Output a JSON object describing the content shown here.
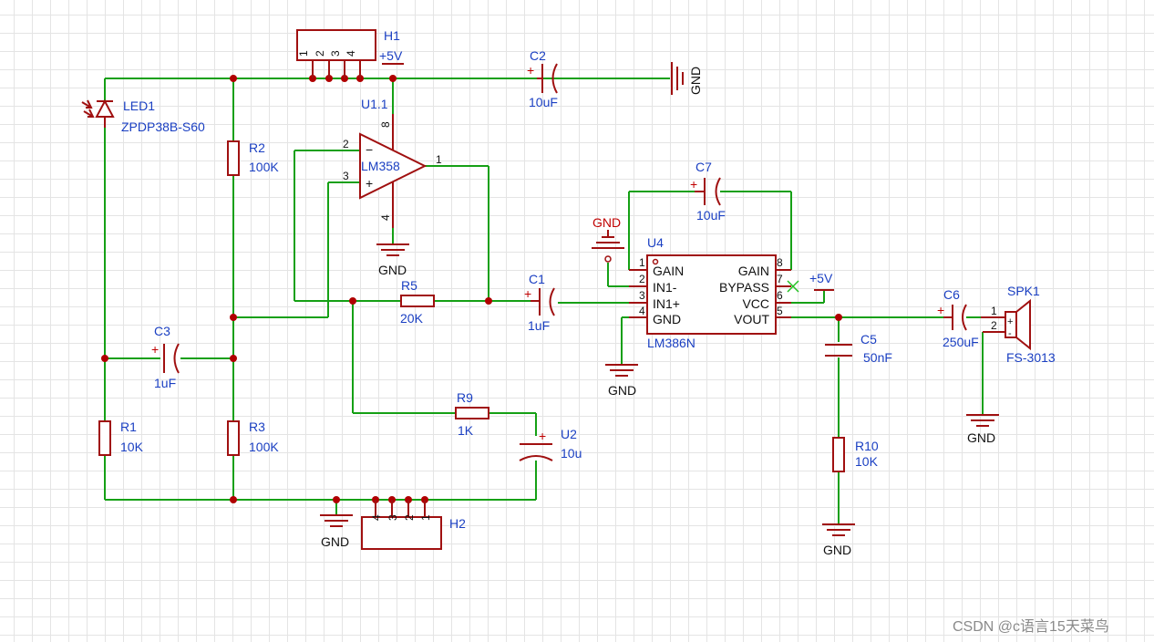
{
  "components": {
    "h1": {
      "ref": "H1",
      "pins": [
        "1",
        "2",
        "3",
        "4"
      ]
    },
    "h2": {
      "ref": "H2",
      "pins": [
        "4",
        "3",
        "2",
        "1"
      ]
    },
    "led1": {
      "ref": "LED1",
      "value": "ZPDP38B-S60"
    },
    "r1": {
      "ref": "R1",
      "value": "10K"
    },
    "r2": {
      "ref": "R2",
      "value": "100K"
    },
    "r3": {
      "ref": "R3",
      "value": "100K"
    },
    "r5": {
      "ref": "R5",
      "value": "20K"
    },
    "r9": {
      "ref": "R9",
      "value": "1K"
    },
    "r10": {
      "ref": "R10",
      "value": "10K"
    },
    "c1": {
      "ref": "C1",
      "value": "1uF"
    },
    "c2": {
      "ref": "C2",
      "value": "10uF"
    },
    "c3": {
      "ref": "C3",
      "value": "1uF"
    },
    "c5": {
      "ref": "C5",
      "value": "50nF"
    },
    "c6": {
      "ref": "C6",
      "value": "250uF"
    },
    "c7": {
      "ref": "C7",
      "value": "10uF"
    },
    "u2": {
      "ref": "U2",
      "value": "10u"
    },
    "u1": {
      "ref": "U1.1",
      "value": "LM358",
      "pin_minus": "2",
      "pin_plus": "3",
      "pin_out": "1",
      "pin_vcc": "8",
      "pin_gnd": "4",
      "minus": "−",
      "plus": "+"
    },
    "u4": {
      "ref": "U4",
      "value": "LM386N",
      "left_pins": [
        {
          "num": "1",
          "name": "GAIN"
        },
        {
          "num": "2",
          "name": "IN1-"
        },
        {
          "num": "3",
          "name": "IN1+"
        },
        {
          "num": "4",
          "name": "GND"
        }
      ],
      "right_pins": [
        {
          "num": "8",
          "name": "GAIN"
        },
        {
          "num": "7",
          "name": "BYPASS"
        },
        {
          "num": "6",
          "name": "VCC"
        },
        {
          "num": "5",
          "name": "VOUT"
        }
      ]
    },
    "spk1": {
      "ref": "SPK1",
      "value": "FS-3013",
      "pin1": "1",
      "pin2": "2",
      "plus": "+",
      "minus": "-"
    }
  },
  "net_labels": {
    "vcc_h1": "+5V",
    "vcc_u4": "+5V",
    "gnd_c2": "GND",
    "gnd_u1": "GND",
    "gnd_u4_top": "GND",
    "gnd_u4": "GND",
    "gnd_h2": "GND",
    "gnd_r10": "GND",
    "gnd_spk": "GND"
  },
  "colors": {
    "wire": "#15a015",
    "component": "#a01010",
    "label": "#1a3fc2",
    "gnd_highlight": "#c00000",
    "grid": "#e4e4e4"
  },
  "watermark": "CSDN @c语言15天菜鸟"
}
